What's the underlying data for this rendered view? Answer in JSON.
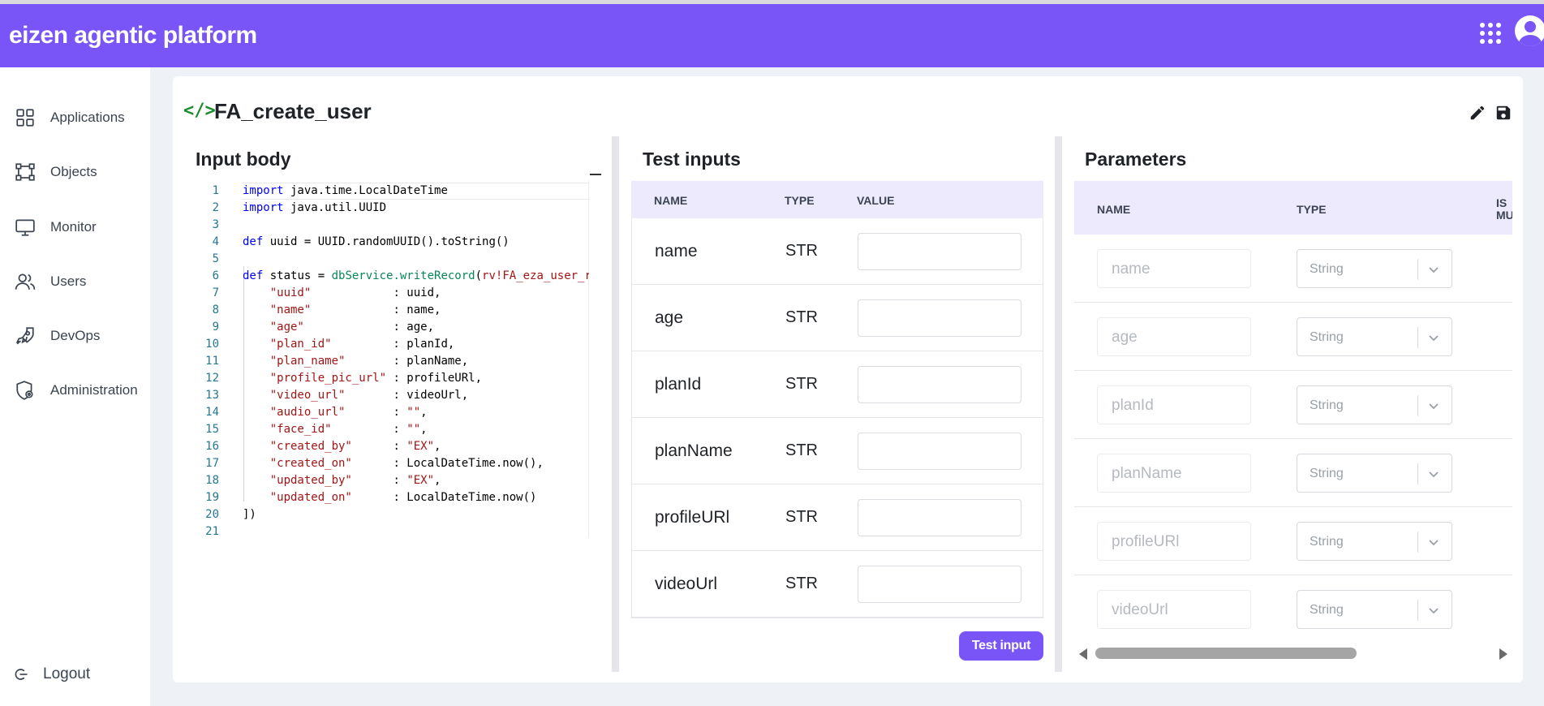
{
  "app": {
    "brand": "eizen agentic platform"
  },
  "sidebar": {
    "items": [
      {
        "label": "Applications",
        "icon": "grid-icon"
      },
      {
        "label": "Objects",
        "icon": "objects-icon"
      },
      {
        "label": "Monitor",
        "icon": "monitor-icon"
      },
      {
        "label": "Users",
        "icon": "users-icon"
      },
      {
        "label": "DevOps",
        "icon": "rocket-icon"
      },
      {
        "label": "Administration",
        "icon": "shield-gear-icon"
      }
    ],
    "logout_label": "Logout"
  },
  "page": {
    "title": "FA_create_user",
    "title_icon": "</>"
  },
  "input_body": {
    "title": "Input body",
    "lines": [
      {
        "n": "1",
        "html": "<span class=\"kw\">import</span> java.time.LocalDateTime"
      },
      {
        "n": "2",
        "html": "<span class=\"kw\">import</span> java.util.UUID"
      },
      {
        "n": "3",
        "html": ""
      },
      {
        "n": "4",
        "html": "<span class=\"kw\">def</span> uuid = UUID.randomUUID().toString()"
      },
      {
        "n": "5",
        "html": ""
      },
      {
        "n": "6",
        "html": "<span class=\"kw\">def</span> status = <span class=\"fn\">dbService.writeRecord</span>(<span class=\"str\">rv!FA_eza_user_r</span>"
      },
      {
        "n": "7",
        "html": "    <span class=\"str\">\"uuid\"</span>            : uuid,"
      },
      {
        "n": "8",
        "html": "    <span class=\"str\">\"name\"</span>            : name,"
      },
      {
        "n": "9",
        "html": "    <span class=\"str\">\"age\"</span>             : age,"
      },
      {
        "n": "10",
        "html": "    <span class=\"str\">\"plan_id\"</span>         : planId,"
      },
      {
        "n": "11",
        "html": "    <span class=\"str\">\"plan_name\"</span>       : planName,"
      },
      {
        "n": "12",
        "html": "    <span class=\"str\">\"profile_pic_url\"</span> : profileURl,"
      },
      {
        "n": "13",
        "html": "    <span class=\"str\">\"video_url\"</span>       : videoUrl,"
      },
      {
        "n": "14",
        "html": "    <span class=\"str\">\"audio_url\"</span>       : <span class=\"str\">\"\"</span>,"
      },
      {
        "n": "15",
        "html": "    <span class=\"str\">\"face_id\"</span>         : <span class=\"str\">\"\"</span>,"
      },
      {
        "n": "16",
        "html": "    <span class=\"str\">\"created_by\"</span>      : <span class=\"str\">\"EX\"</span>,"
      },
      {
        "n": "17",
        "html": "    <span class=\"str\">\"created_on\"</span>      : LocalDateTime.now(),"
      },
      {
        "n": "18",
        "html": "    <span class=\"str\">\"updated_by\"</span>      : <span class=\"str\">\"EX\"</span>,"
      },
      {
        "n": "19",
        "html": "    <span class=\"str\">\"updated_on\"</span>      : LocalDateTime.now()"
      },
      {
        "n": "20",
        "html": "])"
      },
      {
        "n": "21",
        "html": ""
      }
    ]
  },
  "test_inputs": {
    "title": "Test inputs",
    "headers": {
      "name": "NAME",
      "type": "TYPE",
      "value": "VALUE"
    },
    "rows": [
      {
        "name": "name",
        "type": "STR",
        "value": ""
      },
      {
        "name": "age",
        "type": "STR",
        "value": ""
      },
      {
        "name": "planId",
        "type": "STR",
        "value": ""
      },
      {
        "name": "planName",
        "type": "STR",
        "value": ""
      },
      {
        "name": "profileURl",
        "type": "STR",
        "value": ""
      },
      {
        "name": "videoUrl",
        "type": "STR",
        "value": ""
      }
    ],
    "button_label": "Test input"
  },
  "parameters": {
    "title": "Parameters",
    "headers": {
      "name": "NAME",
      "type": "TYPE",
      "is_multi": "IS MU"
    },
    "rows": [
      {
        "name": "name",
        "type": "String"
      },
      {
        "name": "age",
        "type": "String"
      },
      {
        "name": "planId",
        "type": "String"
      },
      {
        "name": "planName",
        "type": "String"
      },
      {
        "name": "profileURl",
        "type": "String"
      },
      {
        "name": "videoUrl",
        "type": "String"
      }
    ]
  },
  "colors": {
    "accent": "#7955f8",
    "header_row": "#eeeafd",
    "code_icon": "#1e8a2c"
  }
}
